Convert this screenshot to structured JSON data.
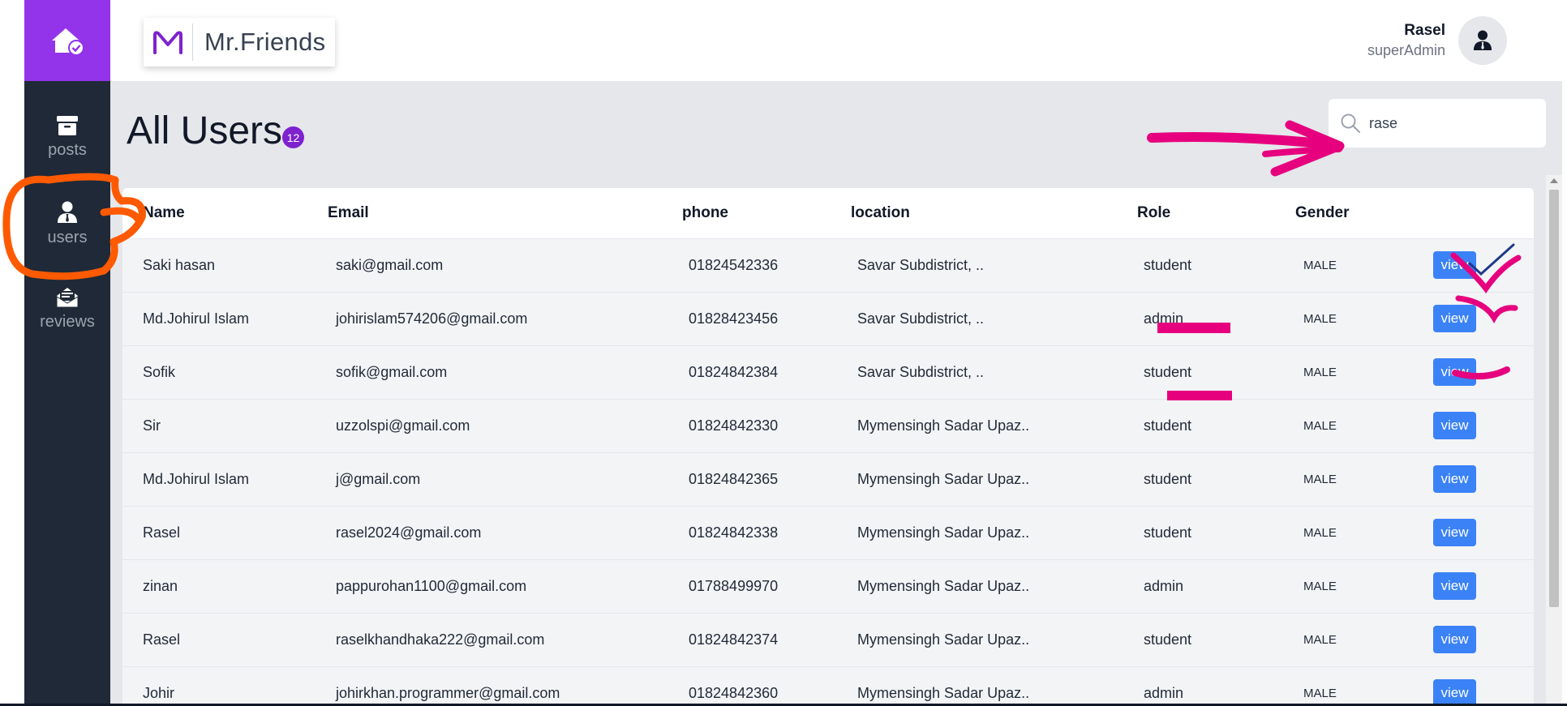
{
  "sidebar": {
    "items": [
      {
        "label": "posts",
        "icon": "archive-icon"
      },
      {
        "label": "users",
        "icon": "user-tie-icon"
      },
      {
        "label": "reviews",
        "icon": "envelope-open-icon"
      }
    ]
  },
  "header": {
    "brand": "Mr.Friends",
    "user_name": "Rasel",
    "user_role": "superAdmin"
  },
  "page": {
    "title": "All Users",
    "count": "12"
  },
  "search": {
    "value": "rase",
    "placeholder": ""
  },
  "table": {
    "columns": [
      "Name",
      "Email",
      "phone",
      "location",
      "Role",
      "Gender"
    ],
    "action_label": "view",
    "rows": [
      {
        "name": "Saki hasan",
        "email": "saki@gmail.com",
        "phone": "01824542336",
        "location": "Savar Subdistrict, ..",
        "role": "student",
        "gender": "MALE"
      },
      {
        "name": "Md.Johirul Islam",
        "email": "johirislam574206@gmail.com",
        "phone": "01828423456",
        "location": "Savar Subdistrict, ..",
        "role": "admin",
        "gender": "MALE"
      },
      {
        "name": "Sofik",
        "email": "sofik@gmail.com",
        "phone": "01824842384",
        "location": "Savar Subdistrict, ..",
        "role": "student",
        "gender": "MALE"
      },
      {
        "name": "Sir",
        "email": "uzzolspi@gmail.com",
        "phone": "01824842330",
        "location": "Mymensingh Sadar Upaz..",
        "role": "student",
        "gender": "MALE"
      },
      {
        "name": "Md.Johirul Islam",
        "email": "j@gmail.com",
        "phone": "01824842365",
        "location": "Mymensingh Sadar Upaz..",
        "role": "student",
        "gender": "MALE"
      },
      {
        "name": "Rasel",
        "email": "rasel2024@gmail.com",
        "phone": "01824842338",
        "location": "Mymensingh Sadar Upaz..",
        "role": "student",
        "gender": "MALE"
      },
      {
        "name": "zinan",
        "email": "pappurohan1100@gmail.com",
        "phone": "01788499970",
        "location": "Mymensingh Sadar Upaz..",
        "role": "admin",
        "gender": "MALE"
      },
      {
        "name": "Rasel",
        "email": "raselkhandhaka222@gmail.com",
        "phone": "01824842374",
        "location": "Mymensingh Sadar Upaz..",
        "role": "student",
        "gender": "MALE"
      },
      {
        "name": "Johir",
        "email": "johirkhan.programmer@gmail.com",
        "phone": "01824842360",
        "location": "Mymensingh Sadar Upaz..",
        "role": "admin",
        "gender": "MALE"
      }
    ]
  },
  "colors": {
    "sidebar_bg": "#1f2937",
    "brand_purple": "#9333ea",
    "badge_purple": "#7e22ce",
    "button_blue": "#3b82f6",
    "annotation_orange": "#ff5a00",
    "annotation_magenta": "#e6007e"
  }
}
